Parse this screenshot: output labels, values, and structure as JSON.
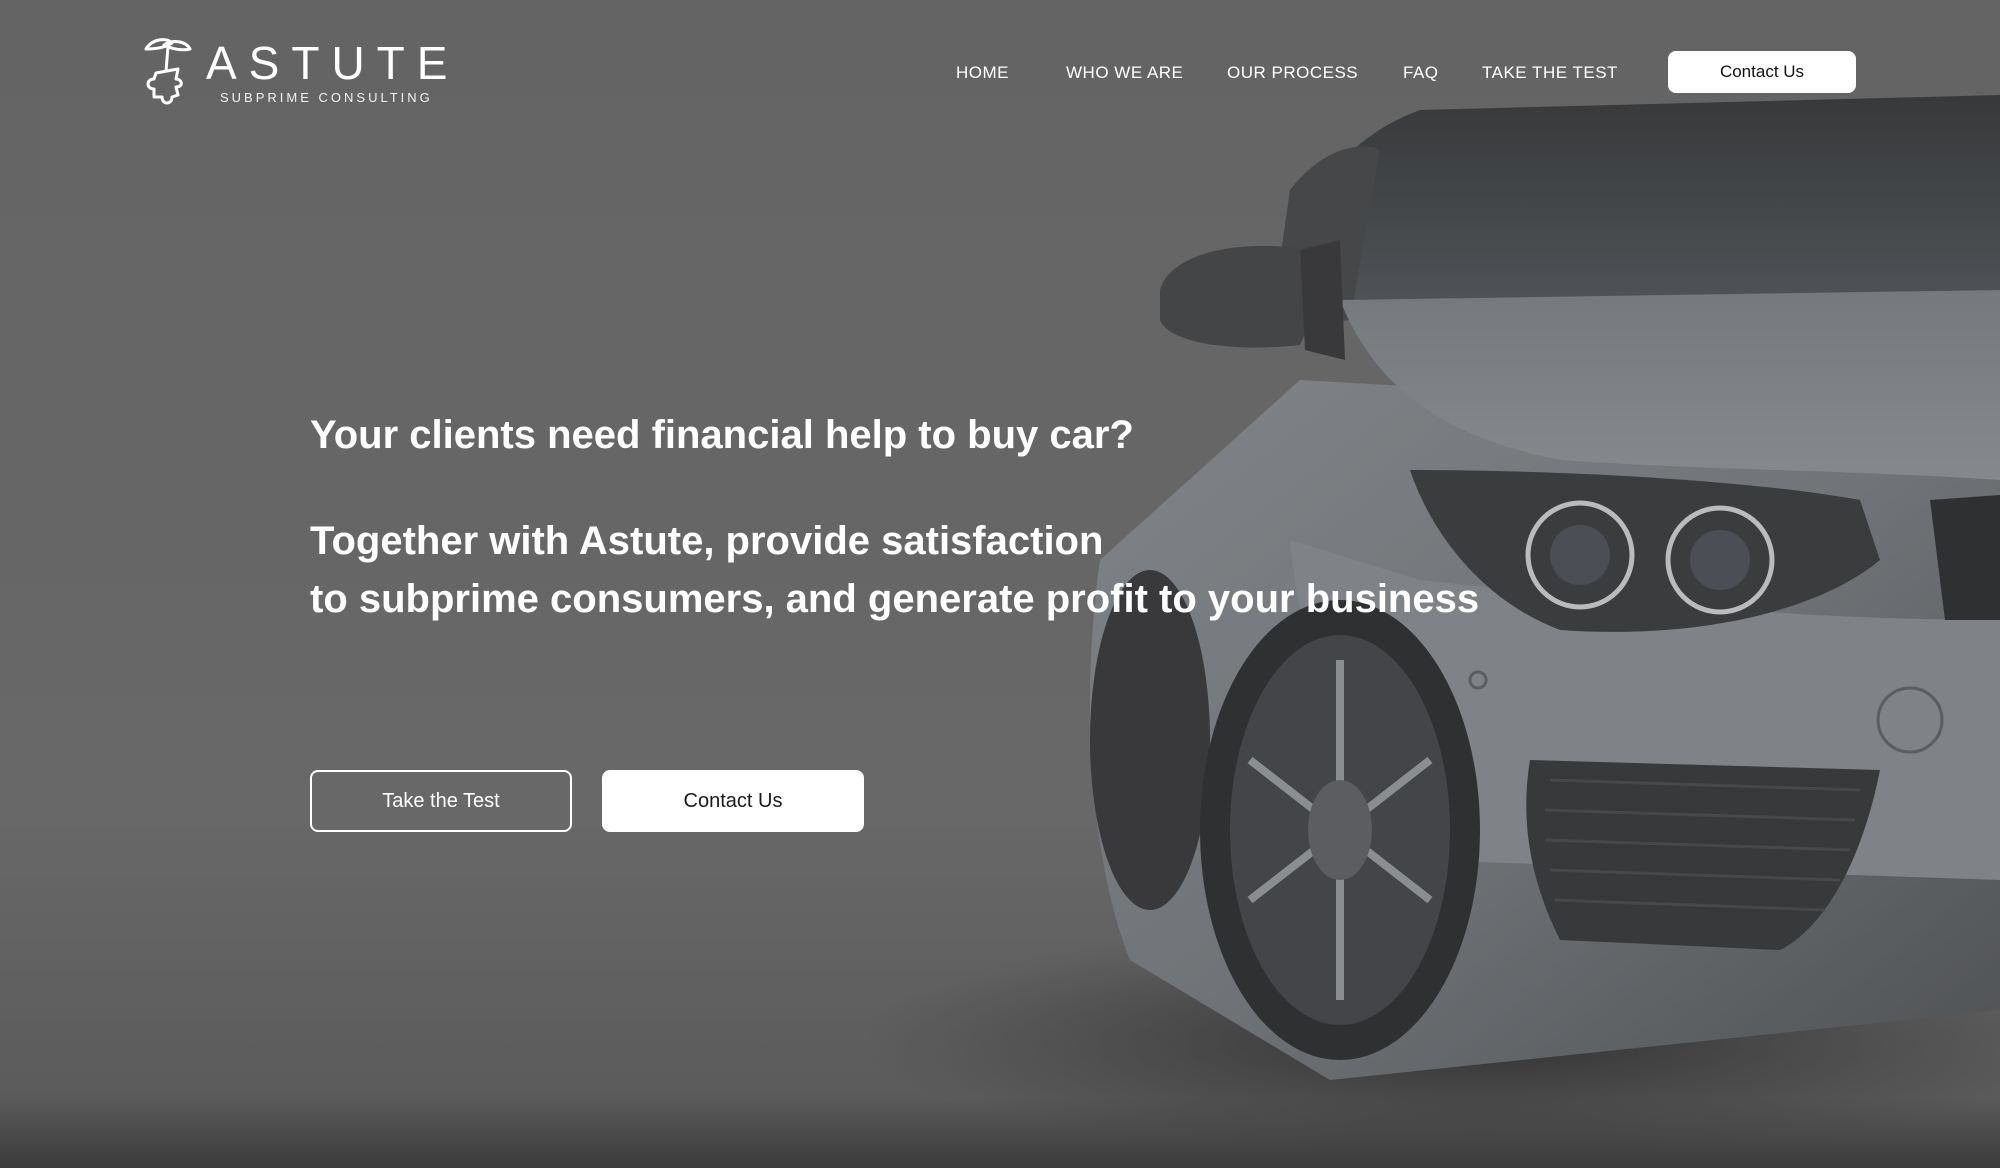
{
  "brand": {
    "name": "ASTUTE",
    "tagline": "SUBPRIME CONSULTING",
    "logo_icon": "tree-puzzle-logo-icon"
  },
  "nav": {
    "items": [
      {
        "label": "HOME"
      },
      {
        "label": "WHO WE ARE"
      },
      {
        "label": "OUR PROCESS"
      },
      {
        "label": "FAQ"
      },
      {
        "label": "TAKE THE TEST"
      }
    ],
    "contact_button": "Contact Us"
  },
  "hero": {
    "headline": "Your clients need financial help to buy car?",
    "subline_1": "Together with Astute, provide satisfaction",
    "subline_2": "to subprime consumers, and generate profit to your business",
    "primary_button": "Take the Test",
    "secondary_button": "Contact Us",
    "image": "sports-car-front-photo"
  },
  "colors": {
    "overlay": "#666666",
    "text": "#ffffff",
    "button_bg": "#ffffff",
    "button_text": "#1a1a1a"
  }
}
